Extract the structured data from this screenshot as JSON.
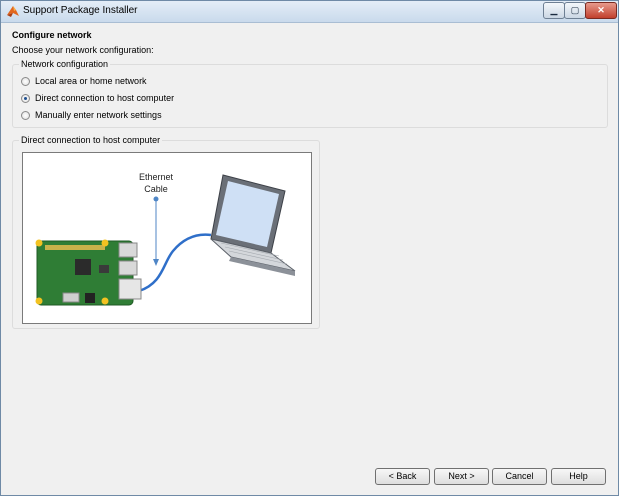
{
  "window": {
    "title": "Support Package Installer",
    "minimize_glyph": "▁",
    "maximize_glyph": "▢",
    "close_glyph": "✕"
  },
  "page": {
    "heading": "Configure network",
    "instruction": "Choose your network configuration:"
  },
  "network_group": {
    "legend": "Network configuration",
    "options": [
      {
        "label": "Local area or home network",
        "selected": false
      },
      {
        "label": "Direct connection to host computer",
        "selected": true
      },
      {
        "label": "Manually enter network settings",
        "selected": false
      }
    ]
  },
  "diagram_group": {
    "legend": "Direct connection to host computer",
    "cable_label_line1": "Ethernet",
    "cable_label_line2": "Cable"
  },
  "buttons": {
    "back": "< Back",
    "next": "Next >",
    "cancel": "Cancel",
    "help": "Help"
  },
  "colors": {
    "board": "#2f7d35",
    "cable": "#2f6fc9",
    "laptop_body": "#6a6f77",
    "screen": "#cfe0f5"
  }
}
